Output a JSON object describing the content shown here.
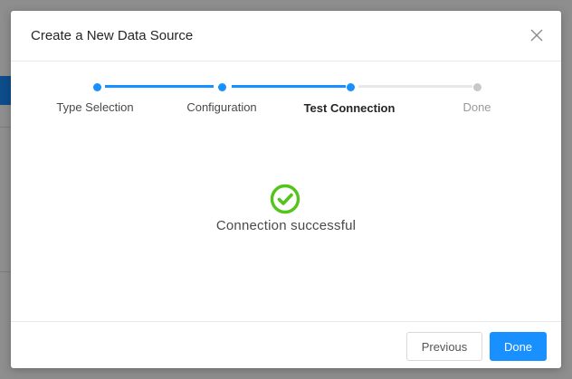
{
  "modal": {
    "title": "Create a New Data Source"
  },
  "steps": [
    {
      "label": "Type Selection",
      "status": "completed"
    },
    {
      "label": "Configuration",
      "status": "completed"
    },
    {
      "label": "Test Connection",
      "status": "current"
    },
    {
      "label": "Done",
      "status": "pending"
    }
  ],
  "result": {
    "message": "Connection successful",
    "icon": "check-circle-icon"
  },
  "footer": {
    "previous_label": "Previous",
    "done_label": "Done"
  },
  "colors": {
    "accent": "#1890ff",
    "success": "#52c41a",
    "pending": "#c8c8c8"
  }
}
